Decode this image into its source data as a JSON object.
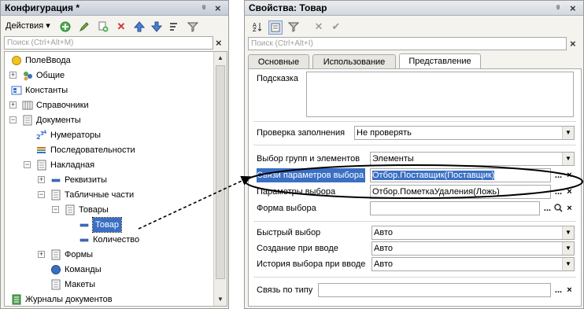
{
  "left_panel": {
    "title": "Конфигурация *",
    "pin": "ᵍ",
    "close": "×",
    "actions_label": "Действия ▾",
    "search_placeholder": "Поиск (Ctrl+Alt+M)",
    "tree": [
      {
        "label": "ПолеВвода",
        "icon": "circle-field-icon",
        "indent": 0,
        "exp": ""
      },
      {
        "label": "Общие",
        "icon": "common-icon",
        "indent": 0,
        "exp": "+"
      },
      {
        "label": "Константы",
        "icon": "constants-icon",
        "indent": 0,
        "exp": ""
      },
      {
        "label": "Справочники",
        "icon": "catalogs-icon",
        "indent": 0,
        "exp": "+"
      },
      {
        "label": "Документы",
        "icon": "documents-icon",
        "indent": 0,
        "exp": "−"
      },
      {
        "label": "Нумераторы",
        "icon": "numerators-icon",
        "indent": 1,
        "exp": ""
      },
      {
        "label": "Последовательности",
        "icon": "sequences-icon",
        "indent": 1,
        "exp": ""
      },
      {
        "label": "Накладная",
        "icon": "document-icon",
        "indent": 1,
        "exp": "−"
      },
      {
        "label": "Реквизиты",
        "icon": "attribute-icon",
        "indent": 2,
        "exp": "+"
      },
      {
        "label": "Табличные части",
        "icon": "table-icon",
        "indent": 2,
        "exp": "−"
      },
      {
        "label": "Товары",
        "icon": "table-icon",
        "indent": 3,
        "exp": "−"
      },
      {
        "label": "Товар",
        "icon": "attribute-icon",
        "indent": 4,
        "exp": "",
        "selected": true
      },
      {
        "label": "Количество",
        "icon": "attribute-icon",
        "indent": 4,
        "exp": ""
      },
      {
        "label": "Формы",
        "icon": "forms-icon",
        "indent": 2,
        "exp": "+"
      },
      {
        "label": "Команды",
        "icon": "commands-icon",
        "indent": 2,
        "exp": ""
      },
      {
        "label": "Макеты",
        "icon": "layouts-icon",
        "indent": 2,
        "exp": ""
      },
      {
        "label": "Журналы документов",
        "icon": "journals-icon",
        "indent": 0,
        "exp": ""
      }
    ]
  },
  "right_panel": {
    "title": "Свойства: Товар",
    "pin": "ᵍ",
    "close": "×",
    "search_placeholder": "Поиск (Ctrl+Alt+I)",
    "tabs": [
      "Основные",
      "Использование",
      "Представление"
    ],
    "active_tab": "Представление",
    "props": {
      "hint_label": "Подсказка",
      "fill_check_label": "Проверка заполнения",
      "fill_check_value": "Не проверять",
      "choose_groups_label": "Выбор групп и элементов",
      "choose_groups_value": "Элементы",
      "links_label": "Связи параметров выбора",
      "links_value": "Отбор.Поставщик(Поставщик)",
      "params_label": "Параметры выбора",
      "params_value": "Отбор.ПометкаУдаления(Ложь)",
      "form_label": "Форма выбора",
      "form_value": "",
      "quick_label": "Быстрый выбор",
      "quick_value": "Авто",
      "create_label": "Создание при вводе",
      "create_value": "Авто",
      "history_label": "История выбора при вводе",
      "history_value": "Авто",
      "type_link_label": "Связь по типу",
      "type_link_value": ""
    },
    "ellipsis": "...",
    "clear": "×",
    "search_glyph": "🔍"
  },
  "colors": {
    "accent": "#3a6fc4",
    "highlight_text": "#ffffff",
    "annotation": "#000000"
  }
}
